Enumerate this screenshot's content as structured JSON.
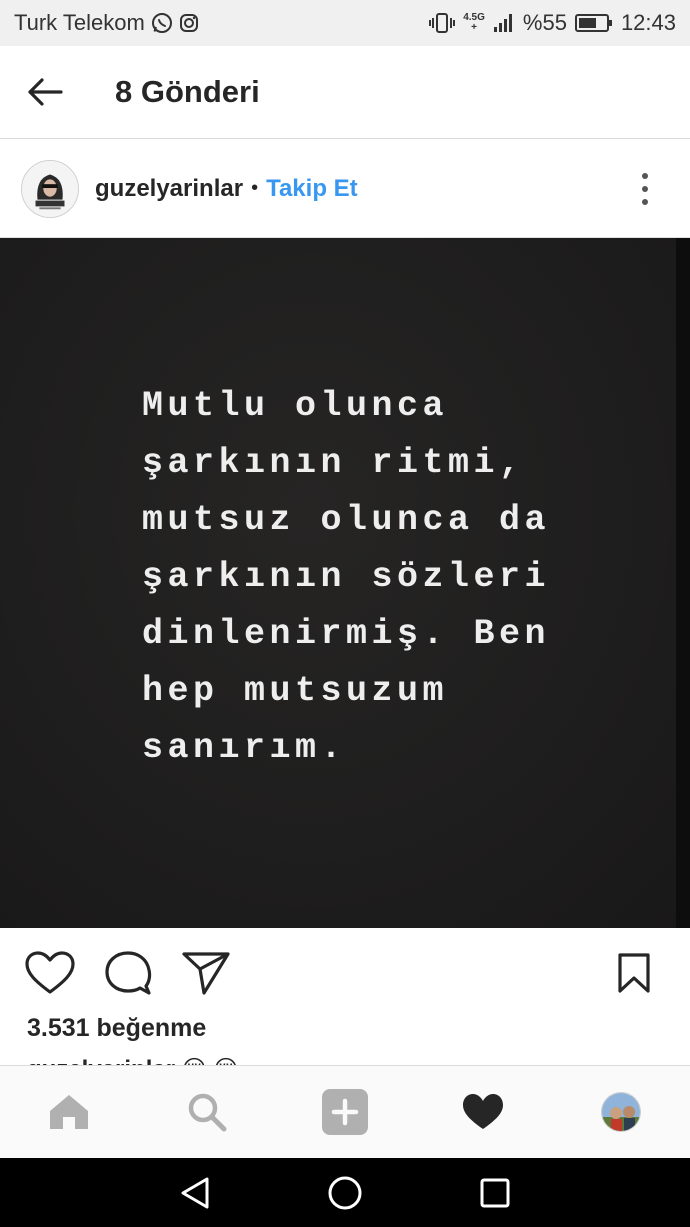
{
  "status_bar": {
    "carrier": "Turk Telekom",
    "network_top": "4.5G",
    "network_bottom": "+",
    "battery": "%55",
    "time": "12:43",
    "icons": [
      "whatsapp-icon",
      "instagram-icon",
      "vibrate-icon",
      "signal-icon",
      "battery-icon"
    ]
  },
  "header": {
    "title": "8 Gönderi",
    "back_icon": "arrow-left-icon"
  },
  "post": {
    "username": "guzelyarinlar",
    "separator": "•",
    "follow_label": "Takip Et",
    "quote_lines": [
      "Mutlu olunca",
      "şarkının ritmi,",
      "mutsuz olunca da",
      "şarkının sözleri",
      "dinlenirmiş. Ben",
      "hep mutsuzum",
      "sanırım."
    ],
    "likes": "3.531 beğenme",
    "caption_peek": "guzelyarinlar 😢 😢"
  },
  "tabs": [
    "home-icon",
    "search-icon",
    "add-post-icon",
    "activity-heart-icon",
    "profile-avatar"
  ],
  "nav": [
    "back-triangle-icon",
    "home-circle-icon",
    "recents-square-icon"
  ],
  "colors": {
    "link": "#3897f0",
    "image_bg": "#1f1e1e",
    "text": "#262626"
  }
}
